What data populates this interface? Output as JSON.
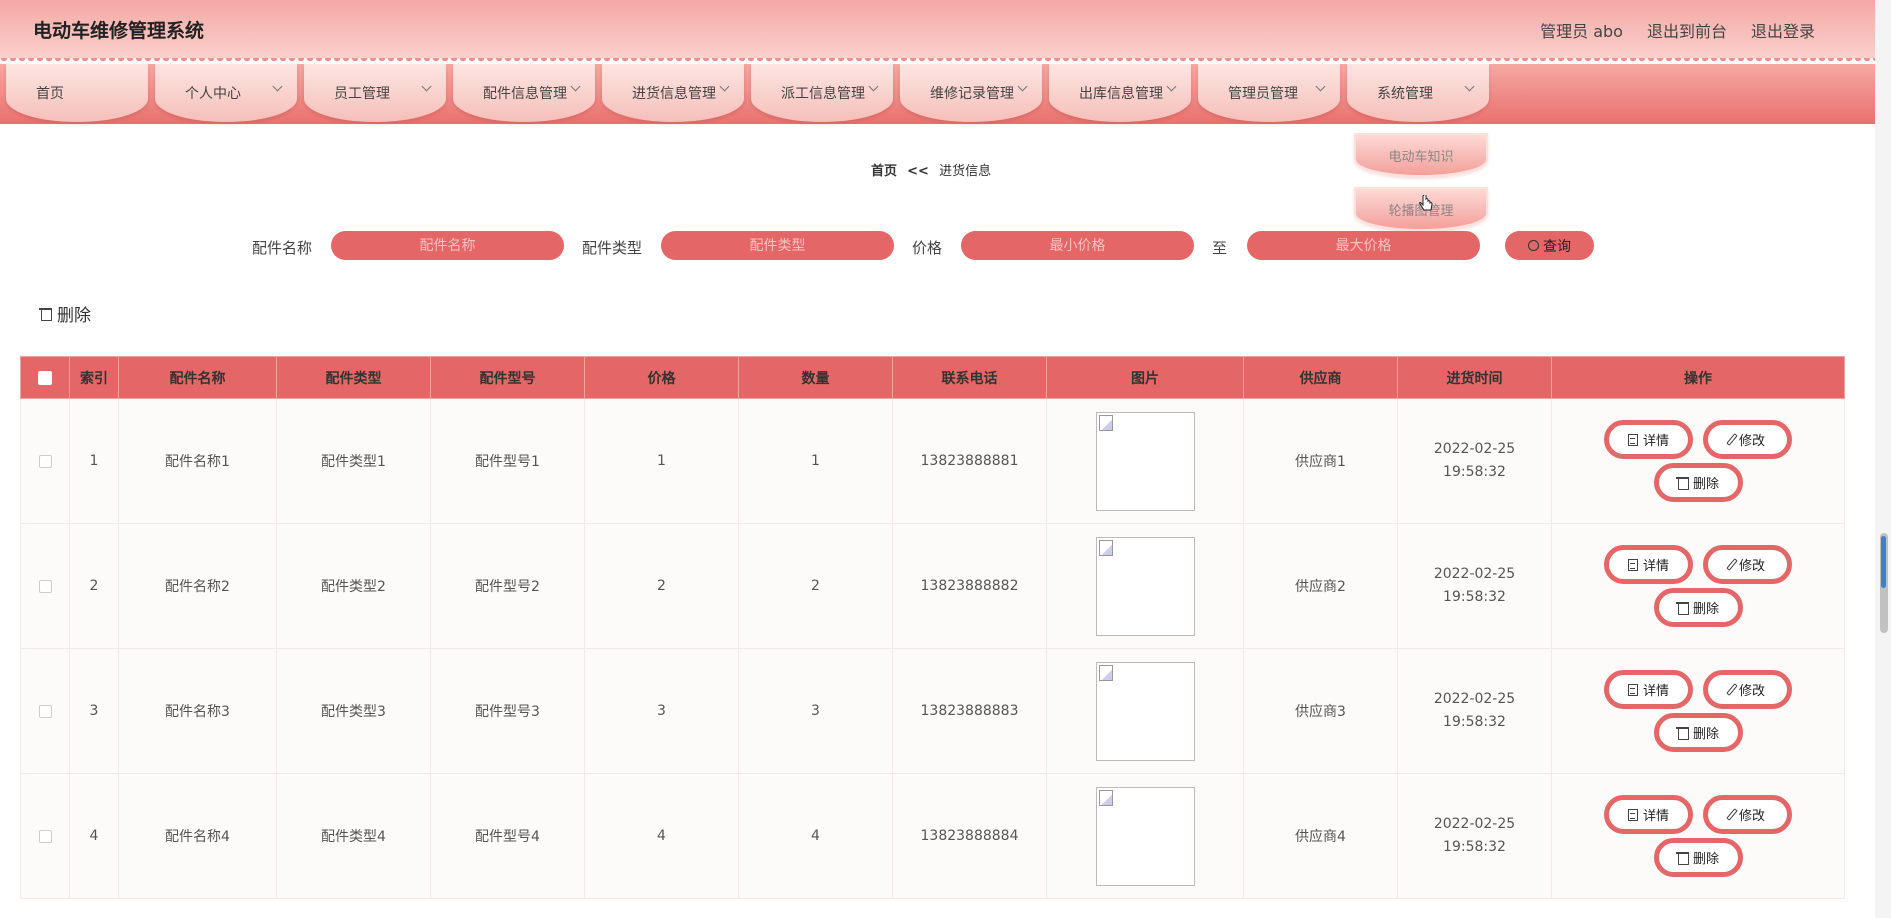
{
  "header": {
    "app_title": "电动车维修管理系统",
    "user": "管理员 abo",
    "to_front": "退出到前台",
    "logout": "退出登录"
  },
  "nav": [
    {
      "label": "首页"
    },
    {
      "label": "个人中心"
    },
    {
      "label": "员工管理"
    },
    {
      "label": "配件信息管理"
    },
    {
      "label": "进货信息管理"
    },
    {
      "label": "派工信息管理"
    },
    {
      "label": "维修记录管理"
    },
    {
      "label": "出库信息管理"
    },
    {
      "label": "管理员管理"
    },
    {
      "label": "系统管理"
    }
  ],
  "dropdown": {
    "items": [
      "电动车知识",
      "轮播图管理"
    ]
  },
  "breadcrumb": {
    "home": "首页",
    "sep": "<<",
    "current": "进货信息"
  },
  "search": {
    "name_label": "配件名称",
    "name_placeholder": "配件名称",
    "type_label": "配件类型",
    "type_placeholder": "配件类型",
    "price_label": "价格",
    "min_placeholder": "最小价格",
    "to": "至",
    "max_placeholder": "最大价格",
    "query": "查询"
  },
  "actions": {
    "delete": "删除"
  },
  "table": {
    "headers": [
      "索引",
      "配件名称",
      "配件类型",
      "配件型号",
      "价格",
      "数量",
      "联系电话",
      "图片",
      "供应商",
      "进货时间",
      "操作"
    ],
    "rows": [
      {
        "index": "1",
        "name": "配件名称1",
        "type": "配件类型1",
        "model": "配件型号1",
        "price": "1",
        "qty": "1",
        "phone": "13823888881",
        "supplier": "供应商1",
        "time": "2022-02-25 19:58:32"
      },
      {
        "index": "2",
        "name": "配件名称2",
        "type": "配件类型2",
        "model": "配件型号2",
        "price": "2",
        "qty": "2",
        "phone": "13823888882",
        "supplier": "供应商2",
        "time": "2022-02-25 19:58:32"
      },
      {
        "index": "3",
        "name": "配件名称3",
        "type": "配件类型3",
        "model": "配件型号3",
        "price": "3",
        "qty": "3",
        "phone": "13823888883",
        "supplier": "供应商3",
        "time": "2022-02-25 19:58:32"
      },
      {
        "index": "4",
        "name": "配件名称4",
        "type": "配件类型4",
        "model": "配件型号4",
        "price": "4",
        "qty": "4",
        "phone": "13823888884",
        "supplier": "供应商4",
        "time": "2022-02-25 19:58:32"
      }
    ],
    "ops": {
      "detail": "详情",
      "edit": "修改",
      "delete": "删除"
    }
  },
  "colors": {
    "accent": "#e56666",
    "header_top": "#f3a8a4",
    "row_bg": "#fdfbf9"
  }
}
